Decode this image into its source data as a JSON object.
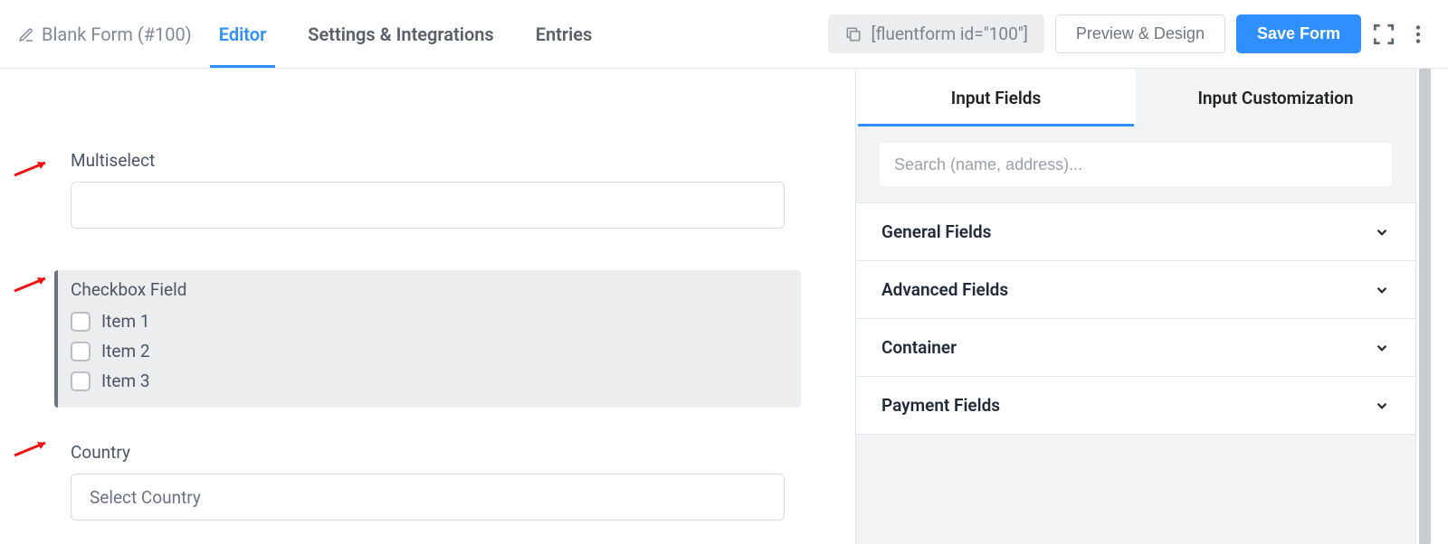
{
  "header": {
    "form_title": "Blank Form (#100)",
    "tabs": {
      "editor": "Editor",
      "settings": "Settings & Integrations",
      "entries": "Entries"
    },
    "shortcode": "[fluentform id=\"100\"]",
    "preview_btn": "Preview & Design",
    "save_btn": "Save Form"
  },
  "canvas": {
    "multiselect": {
      "label": "Multiselect",
      "value": ""
    },
    "checkbox": {
      "label": "Checkbox Field",
      "items": [
        "Item 1",
        "Item 2",
        "Item 3"
      ]
    },
    "country": {
      "label": "Country",
      "placeholder": "Select Country"
    }
  },
  "sidebar": {
    "tabs": {
      "input_fields": "Input Fields",
      "customization": "Input Customization"
    },
    "search_placeholder": "Search (name, address)...",
    "groups": {
      "general": "General Fields",
      "advanced": "Advanced Fields",
      "container": "Container",
      "payment": "Payment Fields"
    }
  }
}
